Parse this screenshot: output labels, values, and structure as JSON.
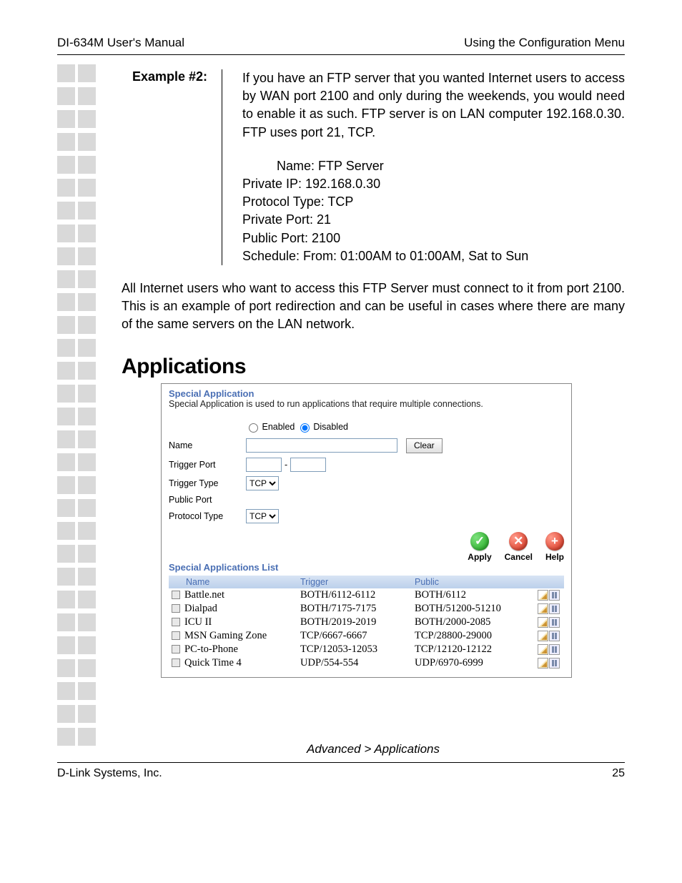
{
  "header": {
    "left": "DI-634M User's Manual",
    "right": "Using the Configuration Menu"
  },
  "example": {
    "label": "Example #2:",
    "text": "If you have an FTP server that you wanted Internet users to access by WAN port 2100 and only during the weekends, you would need to enable it as such. FTP server is on LAN computer 192.168.0.30. FTP uses port 21, TCP.",
    "lines": {
      "name": "Name: FTP Server",
      "private_ip": "Private IP: 192.168.0.30",
      "protocol_type": "Protocol Type: TCP",
      "private_port": "Private Port: 21",
      "public_port": "Public Port: 2100",
      "schedule": "Schedule: From: 01:00AM to 01:00AM, Sat to Sun"
    }
  },
  "paragraph": "All Internet users who want to access this FTP Server must connect to it from port 2100. This is an example of port redirection and can be useful in cases where there are many of the same servers on the LAN network.",
  "section_heading": "Applications",
  "panel": {
    "title": "Special Application",
    "subtitle": "Special Application is used to run applications that require multiple connections.",
    "radio": {
      "enabled": "Enabled",
      "disabled": "Disabled",
      "selected": "disabled"
    },
    "labels": {
      "name": "Name",
      "trigger_port": "Trigger Port",
      "trigger_type": "Trigger Type",
      "public_port": "Public Port",
      "protocol_type": "Protocol Type"
    },
    "values": {
      "name": "",
      "trigger_port_from": "",
      "trigger_port_to": "",
      "trigger_type": "TCP",
      "public_port": "",
      "protocol_type": "TCP"
    },
    "range_sep": "-",
    "clear_button": "Clear",
    "actions": {
      "apply": "Apply",
      "cancel": "Cancel",
      "help": "Help"
    },
    "list_title": "Special Applications List",
    "columns": {
      "name": "Name",
      "trigger": "Trigger",
      "public": "Public"
    },
    "rows": [
      {
        "name": "Battle.net",
        "trigger": "BOTH/6112-6112",
        "public": "BOTH/6112"
      },
      {
        "name": "Dialpad",
        "trigger": "BOTH/7175-7175",
        "public": "BOTH/51200-51210"
      },
      {
        "name": "ICU II",
        "trigger": "BOTH/2019-2019",
        "public": "BOTH/2000-2085"
      },
      {
        "name": "MSN Gaming Zone",
        "trigger": "TCP/6667-6667",
        "public": "TCP/28800-29000"
      },
      {
        "name": "PC-to-Phone",
        "trigger": "TCP/12053-12053",
        "public": "TCP/12120-12122"
      },
      {
        "name": "Quick Time 4",
        "trigger": "UDP/554-554",
        "public": "UDP/6970-6999"
      }
    ]
  },
  "caption": "Advanced > Applications",
  "footer": {
    "left": "D-Link Systems, Inc.",
    "right": "25"
  }
}
